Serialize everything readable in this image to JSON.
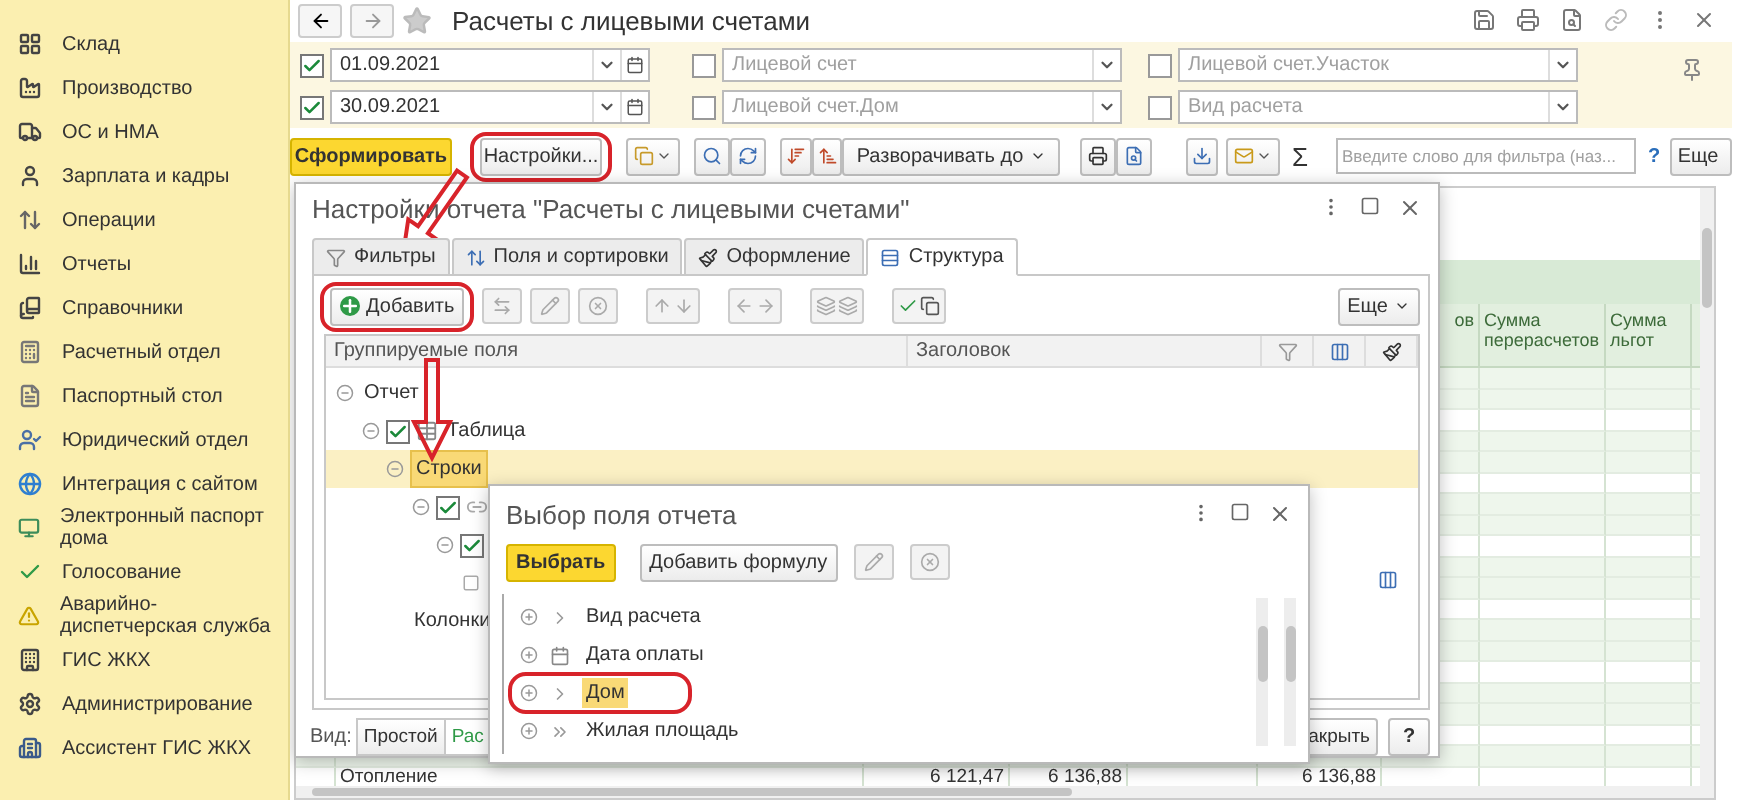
{
  "sidebar": {
    "items": [
      {
        "label": "Склад"
      },
      {
        "label": "Производство"
      },
      {
        "label": "ОС и НМА"
      },
      {
        "label": "Зарплата и кадры"
      },
      {
        "label": "Операции"
      },
      {
        "label": "Отчеты"
      },
      {
        "label": "Справочники"
      },
      {
        "label": "Расчетный отдел"
      },
      {
        "label": "Паспортный стол"
      },
      {
        "label": "Юридический отдел"
      },
      {
        "label": "Интеграция с сайтом"
      },
      {
        "label": "Электронный паспорт дома"
      },
      {
        "label": "Голосование"
      },
      {
        "label": "Аварийно-диспетчерская служба"
      },
      {
        "label": "ГИС ЖКХ"
      },
      {
        "label": "Администрирование"
      },
      {
        "label": "Ассистент ГИС ЖКХ"
      }
    ]
  },
  "header": {
    "title": "Расчеты с лицевыми счетами"
  },
  "filters": {
    "rows": [
      [
        {
          "kind": "date",
          "checked": true,
          "value": "01.09.2021"
        },
        {
          "kind": "select",
          "checked": false,
          "placeholder": "Лицевой счет"
        },
        {
          "kind": "select",
          "checked": false,
          "placeholder": "Лицевой счет.Участок"
        }
      ],
      [
        {
          "kind": "date",
          "checked": true,
          "value": "30.09.2021"
        },
        {
          "kind": "select",
          "checked": false,
          "placeholder": "Лицевой счет.Дом"
        },
        {
          "kind": "select",
          "checked": false,
          "placeholder": "Вид расчета"
        }
      ]
    ]
  },
  "toolbar": {
    "generate": "Сформировать",
    "settings": {
      "label": "Настройки...",
      "circled": true
    },
    "expand": "Разворачивать до",
    "sum": "Σ",
    "search": {
      "placeholder": "Введите слово для фильтра (наз..."
    },
    "help": "?",
    "more": "Еще"
  },
  "report": {
    "columns": [
      "ов",
      "Сумма перерасчетов",
      "Сумма льгот"
    ],
    "rows": [
      {
        "cells": [
          "Отопление",
          "6 121,47",
          "6 136,88",
          "6 136,88"
        ]
      }
    ]
  },
  "settings_dialog": {
    "title": "Настройки отчета \"Расчеты с лицевыми счетами\"",
    "tabs": [
      {
        "label": "Фильтры",
        "selected": false
      },
      {
        "label": "Поля и сортировки",
        "selected": false
      },
      {
        "label": "Оформление",
        "selected": false
      },
      {
        "label": "Структура",
        "selected": true
      }
    ],
    "toolbar": {
      "add": {
        "label": "Добавить",
        "circled": true
      },
      "more": "Еще"
    },
    "tree": {
      "columns": [
        "Группируемые поля",
        "Заголовок"
      ],
      "items": [
        {
          "label": "Отчет",
          "selected": false,
          "children": [
            {
              "label": "Таблица",
              "kind": "table",
              "checked": true,
              "selected": false,
              "children": [
                {
                  "label": "Строки",
                  "selected": true,
                  "children": [
                    {
                      "kind": "grouping",
                      "checked": true,
                      "selected": false,
                      "children": [
                        {
                          "checked": true,
                          "selected": false,
                          "children": [
                            {
                              "kind": "fields",
                              "selected": false
                            }
                          ]
                        }
                      ]
                    }
                  ]
                },
                {
                  "label": "Колонки",
                  "selected": false
                }
              ]
            }
          ]
        }
      ]
    },
    "footer": {
      "view_label": "Вид:",
      "view_options": [
        {
          "label": "Простой",
          "selected": false
        },
        {
          "label": "Рас",
          "selected": true
        }
      ],
      "close": "акрыть",
      "help": "?"
    }
  },
  "field_dialog": {
    "title": "Выбор поля отчета",
    "choose": "Выбрать",
    "add_formula": "Добавить формулу",
    "items": [
      {
        "label": "Вид расчета",
        "kind": "reference",
        "selected": false,
        "circled": false
      },
      {
        "label": "Дата оплаты",
        "kind": "date",
        "selected": false,
        "circled": false
      },
      {
        "label": "Дом",
        "kind": "reference",
        "selected": true,
        "circled": true
      },
      {
        "label": "Жилая площадь",
        "kind": "number",
        "selected": false,
        "circled": false
      }
    ]
  }
}
